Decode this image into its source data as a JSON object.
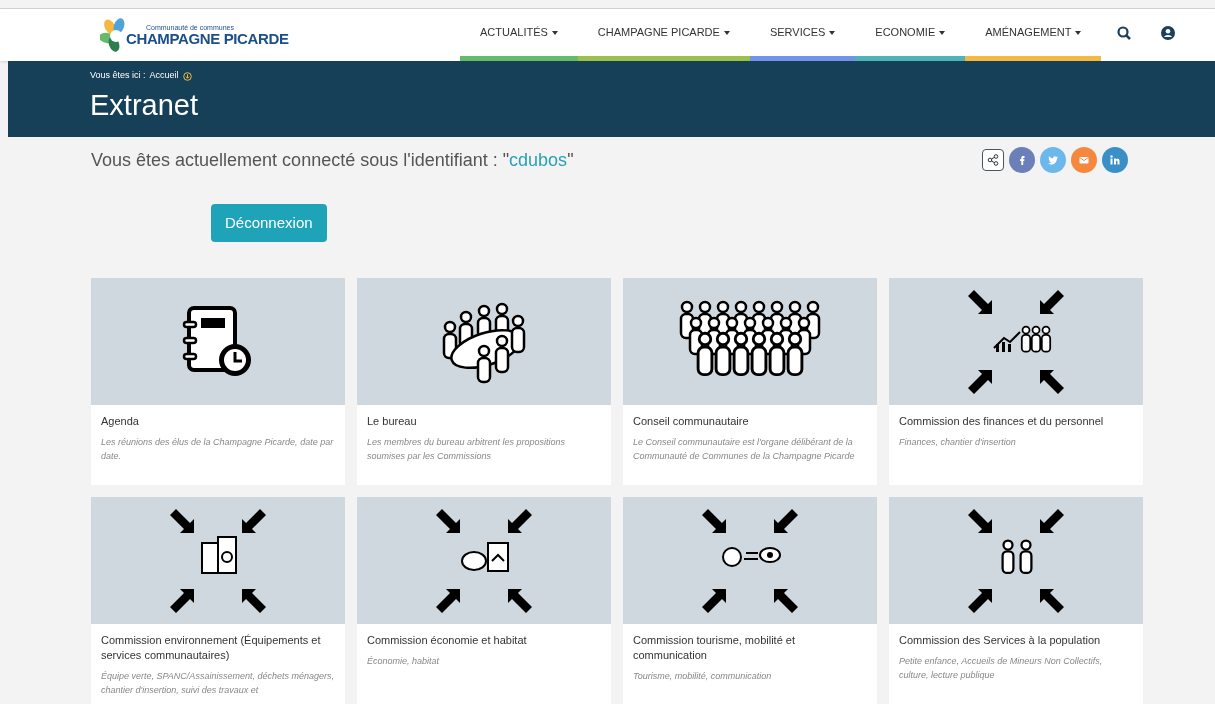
{
  "logo": {
    "tagline": "Communauté de communes",
    "name": "CHAMPAGNE PICARDE"
  },
  "nav": [
    {
      "label": "ACTUALITÉS",
      "color": "#66bb6a"
    },
    {
      "label": "CHAMPAGNE PICARDE",
      "color": "#9cc049"
    },
    {
      "label": "SERVICES",
      "color": "#7393e8"
    },
    {
      "label": "ECONOMIE",
      "color": "#4fb3b8"
    },
    {
      "label": "AMÉNAGEMENT",
      "color": "#f5b940"
    }
  ],
  "breadcrumb": {
    "prefix": "Vous êtes ici :",
    "current": "Accueil"
  },
  "page_title": "Extranet",
  "connected": {
    "text": "Vous êtes actuellement connecté sous l'identifiant : \"",
    "user": "cdubos",
    "suffix": "\""
  },
  "logout_button": "Déconnexion",
  "share": [
    {
      "kind": "share",
      "color": "#ffffff"
    },
    {
      "kind": "facebook",
      "color": "#6b7fb8"
    },
    {
      "kind": "twitter",
      "color": "#6cb8ea"
    },
    {
      "kind": "email",
      "color": "#f5873f"
    },
    {
      "kind": "linkedin",
      "color": "#3a8fc7"
    }
  ],
  "cards": [
    {
      "kind": "agenda",
      "title": "Agenda",
      "description": "Les réunions des élus de la Champagne Picarde, date par date."
    },
    {
      "kind": "meeting",
      "title": "Le bureau",
      "description": "Les membres du bureau arbitrent les propositions soumises par les Commissions"
    },
    {
      "kind": "crowd",
      "title": "Conseil communautaire",
      "description": "Le Conseil communautaire est l'organe délibérant de la Communauté de Communes de la Champagne Picarde"
    },
    {
      "kind": "finance",
      "title": "Commission des finances et du personnel",
      "description": "Finances, chantier d'insertion"
    },
    {
      "kind": "building",
      "title": "Commission environnement (Équipements et services communautaires)",
      "description": "Équipe verte, SPANC/Assainissement, déchets ménagers, chantier d'insertion, suivi des travaux et"
    },
    {
      "kind": "house",
      "title": "Commission économie et habitat",
      "description": "Économie, habitat"
    },
    {
      "kind": "tourism",
      "title": "Commission tourisme, mobilité et communication",
      "description": "Tourisme, mobilité, communication"
    },
    {
      "kind": "family",
      "title": "Commission des Services à la population",
      "description": "Petite enfance, Accueils de Mineurs Non Collectifs, culture, lecture publique"
    }
  ]
}
